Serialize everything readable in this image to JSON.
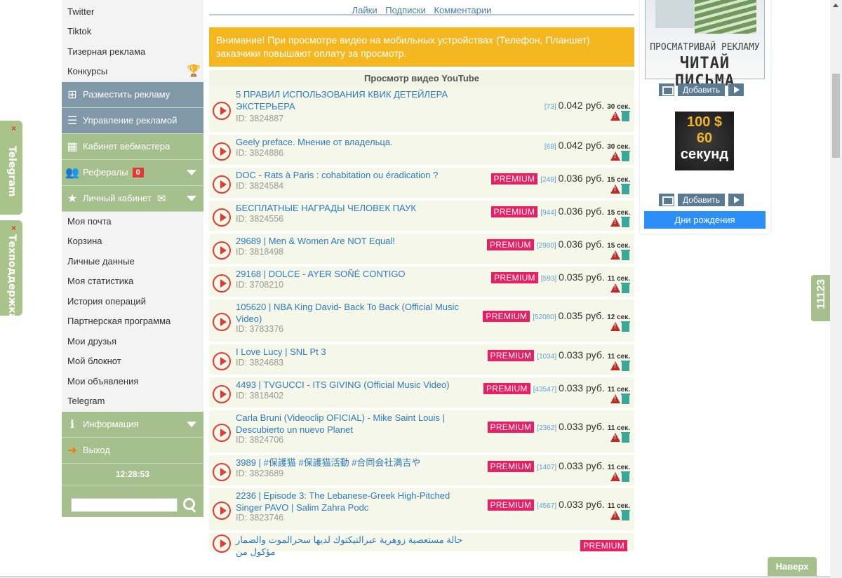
{
  "side_tabs": {
    "telegram": "Telegram",
    "support": "Техподдержка",
    "close_glyph": "×"
  },
  "sidebar": {
    "top_items": [
      "Twitter",
      "Tiktok",
      "Тизерная реклама",
      "Конкурсы"
    ],
    "place_ad": "Разместить рекламу",
    "manage_ads": "Управление рекламой",
    "webmaster": "Кабинет вебмастера",
    "referrals": "Рефералы",
    "referrals_count": "0",
    "personal": "Личный кабинет",
    "personal_items": [
      "Моя почта",
      "Корзина",
      "Личные данные",
      "Моя статистика",
      "История операций",
      "Партнерская программа",
      "Мои друзья",
      "Мой блокнот",
      "Мои объявления",
      "Telegram"
    ],
    "info": "Информация",
    "logout": "Выход",
    "clock": "12:28:53",
    "search_value": ""
  },
  "main": {
    "links": [
      "Лайки",
      "Подписки",
      "Комментарии"
    ],
    "warning": "Внимание! При просмотре видео на мобильных устройствах (Телефон, Планшет) заказчики повышают оплату за просмотр.",
    "list_title": "Просмотр видео YouTube",
    "premium_label": "PREMIUM",
    "videos": [
      {
        "title": "5 ПРАВИЛ ИСПОЛЬЗОВАНИЯ КВИК ДЕТЕЙЛЕРА ЭКСТЕРЬЕРА",
        "id": "ID: 3824887",
        "premium": false,
        "views": "[73]",
        "price": "0.042 руб.",
        "sec": "30 сек."
      },
      {
        "title": "Geely preface. Мнение от владельца.",
        "id": "ID: 3824886",
        "premium": false,
        "views": "[68]",
        "price": "0.042 руб.",
        "sec": "30 сек."
      },
      {
        "title": "DOC - Rats à Paris : cohabitation ou éradication ?",
        "id": "ID: 3824584",
        "premium": true,
        "views": "[248]",
        "price": "0.036 руб.",
        "sec": "15 сек."
      },
      {
        "title": "БЕСПЛАТНЫЕ НАГРАДЫ ЧЕЛОВЕК ПАУК",
        "id": "ID: 3824556",
        "premium": true,
        "views": "[944]",
        "price": "0.036 руб.",
        "sec": "15 сек."
      },
      {
        "title": "29689 | Men & Women Are NOT Equal!",
        "id": "ID: 3818498",
        "premium": true,
        "views": "[2980]",
        "price": "0.036 руб.",
        "sec": "15 сек."
      },
      {
        "title": "29168 | DOLCE - AYER SOÑÉ CONTIGO",
        "id": "ID: 3708210",
        "premium": true,
        "views": "[593]",
        "price": "0.035 руб.",
        "sec": "11 сек."
      },
      {
        "title": "105620 | NBA King David- Back To Back (Official Music Video)",
        "id": "ID: 3783376",
        "premium": true,
        "views": "[52080]",
        "price": "0.035 руб.",
        "sec": "12 сек."
      },
      {
        "title": "I Love Lucy | SNL Pt 3",
        "id": "ID: 3824683",
        "premium": true,
        "views": "[1034]",
        "price": "0.033 руб.",
        "sec": "11 сек."
      },
      {
        "title": "4493 | TVGUCCI - ITS GIVING (Official Music Video)",
        "id": "ID: 3818402",
        "premium": true,
        "views": "[43547]",
        "price": "0.033 руб.",
        "sec": "11 сек."
      },
      {
        "title": "Carla Bruni (Videoclip OFICIAL) - Mike Saint Louis | Descubierto un nuevo Planet",
        "id": "ID: 3824706",
        "premium": true,
        "views": "[2362]",
        "price": "0.033 руб.",
        "sec": "11 сек."
      },
      {
        "title": "3989 | #保護猫 #保護猫活動 #合同会社満吉や",
        "id": "ID: 3823689",
        "premium": true,
        "views": "[1407]",
        "price": "0.033 руб.",
        "sec": "11 сек."
      },
      {
        "title": "2236 | Episode 3: The Lebanese-Greek High-Pitched Singer PAVO | Salim Zahra Podc",
        "id": "ID: 3823746",
        "premium": true,
        "views": "[4567]",
        "price": "0.033 руб.",
        "sec": "11 сек."
      },
      {
        "title": "حالة مستعصية زوهرية عبرالتيكتوك لديها سحرالموت والضمار مؤكول من",
        "id": "",
        "premium": true,
        "views": "",
        "price": "",
        "sec": ""
      }
    ]
  },
  "right": {
    "banner1_line1": "ПРОСМАТРИВАЙ РЕКЛАМУ",
    "banner1_line2": "ЧИТАЙ ПИСЬМА",
    "add_label": "Добавить",
    "banner2": [
      "100 $",
      "60",
      "секунд"
    ],
    "birthday": "Дни рождения"
  },
  "counter": "11123",
  "to_top": "Наверх",
  "colors": {
    "accent_green": "#a6c08d",
    "warning": "#f5b720",
    "premium": "#e91e63",
    "link": "#2d7ac4",
    "birthday_button": "#2c8ef8"
  }
}
